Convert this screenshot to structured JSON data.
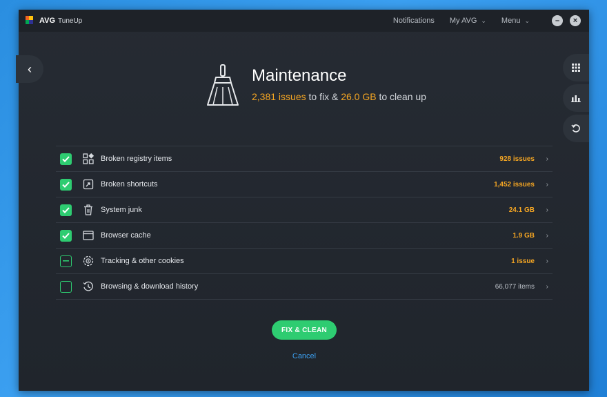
{
  "app": {
    "brand_name": "AVG",
    "product_name": "TuneUp"
  },
  "top_nav": {
    "notifications": "Notifications",
    "my_avg": "My AVG",
    "menu": "Menu"
  },
  "header": {
    "title": "Maintenance",
    "issues_count": "2,381 issues",
    "issues_suffix": " to fix & ",
    "size": "26.0 GB",
    "size_suffix": " to clean up"
  },
  "items": [
    {
      "label": "Broken registry items",
      "value": "928 issues",
      "state": "checked",
      "icon": "registry-icon"
    },
    {
      "label": "Broken shortcuts",
      "value": "1,452 issues",
      "state": "checked",
      "icon": "shortcut-icon"
    },
    {
      "label": "System junk",
      "value": "24.1 GB",
      "state": "checked",
      "icon": "trash-icon"
    },
    {
      "label": "Browser cache",
      "value": "1.9 GB",
      "state": "checked",
      "icon": "browser-window-icon"
    },
    {
      "label": "Tracking & other cookies",
      "value": "1 issue",
      "state": "partial",
      "icon": "cookie-icon"
    },
    {
      "label": "Browsing & download history",
      "value": "66,077 items",
      "state": "unchecked",
      "icon": "history-clock-icon"
    }
  ],
  "actions": {
    "fix_clean": "FIX & CLEAN",
    "cancel": "Cancel"
  },
  "colors": {
    "accent_green": "#2ecc71",
    "accent_orange": "#f5a623",
    "link_blue": "#3ba0f0",
    "window_bg": "#22272e"
  }
}
